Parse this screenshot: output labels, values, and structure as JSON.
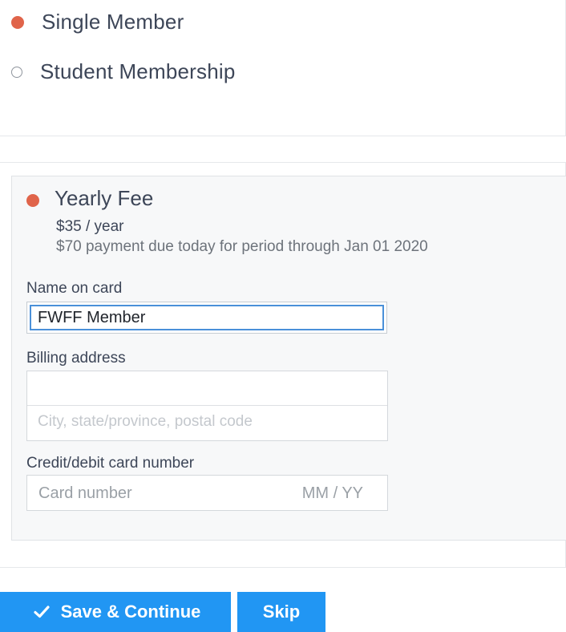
{
  "membership": {
    "options": [
      {
        "label": "Single Member",
        "selected": true
      },
      {
        "label": "Student Membership",
        "selected": false
      }
    ]
  },
  "fee": {
    "title": "Yearly Fee",
    "price": "$35 / year",
    "note": "$70 payment due today for period through Jan 01 2020",
    "selected": true
  },
  "form": {
    "name_label": "Name on card",
    "name_value": "FWFF Member",
    "billing_label": "Billing address",
    "billing_line1_value": "",
    "billing_line2_placeholder": "City, state/province, postal code",
    "card_label": "Credit/debit card number",
    "card_placeholder": "Card number",
    "expiry_placeholder": "MM / YY"
  },
  "buttons": {
    "save_label": "Save & Continue",
    "skip_label": "Skip"
  },
  "colors": {
    "accent": "#e0644a",
    "primary_button": "#2196f3",
    "focus_border": "#4a90d9"
  }
}
